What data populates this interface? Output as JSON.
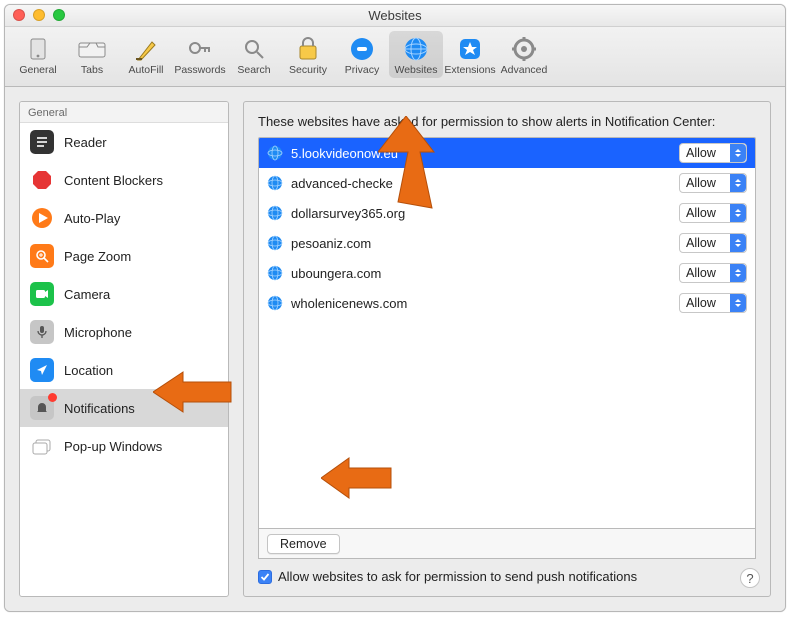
{
  "window": {
    "title": "Websites"
  },
  "toolbar": {
    "items": [
      {
        "label": "General"
      },
      {
        "label": "Tabs"
      },
      {
        "label": "AutoFill"
      },
      {
        "label": "Passwords"
      },
      {
        "label": "Search"
      },
      {
        "label": "Security"
      },
      {
        "label": "Privacy"
      },
      {
        "label": "Websites"
      },
      {
        "label": "Extensions"
      },
      {
        "label": "Advanced"
      }
    ],
    "active_index": 7
  },
  "sidebar": {
    "group": "General",
    "items": [
      {
        "label": "Reader"
      },
      {
        "label": "Content Blockers"
      },
      {
        "label": "Auto-Play"
      },
      {
        "label": "Page Zoom"
      },
      {
        "label": "Camera"
      },
      {
        "label": "Microphone"
      },
      {
        "label": "Location"
      },
      {
        "label": "Notifications"
      },
      {
        "label": "Pop-up Windows"
      }
    ],
    "selected_index": 7
  },
  "main": {
    "caption": "These websites have asked for permission to show alerts in Notification Center:",
    "sites": [
      {
        "domain": "5.lookvideonow.eu",
        "permission": "Allow",
        "selected": true
      },
      {
        "domain": "advanced-checke",
        "permission": "Allow",
        "selected": false
      },
      {
        "domain": "dollarsurvey365.org",
        "permission": "Allow",
        "selected": false
      },
      {
        "domain": "pesoaniz.com",
        "permission": "Allow",
        "selected": false
      },
      {
        "domain": "uboungera.com",
        "permission": "Allow",
        "selected": false
      },
      {
        "domain": "wholenicenews.com",
        "permission": "Allow",
        "selected": false
      }
    ],
    "remove_label": "Remove",
    "checkbox_label": "Allow websites to ask for permission to send push notifications",
    "checkbox_checked": true
  },
  "help": "?"
}
